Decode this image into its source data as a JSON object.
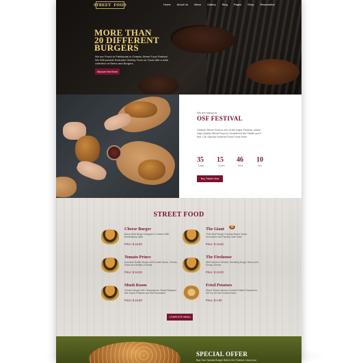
{
  "nav": {
    "logo_left": "STREET",
    "logo_right": "FOOD",
    "items": [
      "Home",
      "About Us",
      "Menu",
      "Gallery",
      "Blog",
      "Pages",
      "Shop",
      "Reservation"
    ]
  },
  "hero": {
    "title_line1": "MORE THAN",
    "title_line2": "20 DIFFERENT",
    "title_line3": "BURGERS",
    "text": "We are Proud to Participate in Orlando Street Food Festival. We Will provide Exclusive Streety Food on Truck with a wide collection of Beers and Burgers.",
    "button": "Discover the Event"
  },
  "festival": {
    "pre": "We are happy to",
    "title": "OSF FESTIVAL",
    "description": "Orlando Street Food is one of the major Festival, where High Quality Street Food is Considered the Health you'll find, Car Special Gourmet Food Truck Here.",
    "countdown": [
      {
        "value": "35",
        "unit": "Days"
      },
      {
        "value": "15",
        "unit": "Hours"
      },
      {
        "value": "46",
        "unit": "Mins"
      },
      {
        "value": "10",
        "unit": "Sec"
      }
    ],
    "button": "Buy Tickets Now"
  },
  "menu": {
    "title": "STREET FOOD",
    "items": [
      {
        "name": "Cheese Burger",
        "desc": "Bacon Beef Burger Wrapped in Cheese With Breathtaking Taste",
        "price": "Price: $ 15.50"
      },
      {
        "name": "The Giant",
        "desc": "Thick Beef Burger Cheddar Bacon Salad, Cucumbers and Paprika Giant Taste",
        "price": "Price: $ 15.50"
      },
      {
        "name": "Tomato Prince",
        "desc": "American Buffalo Burger with Double Bacon, Tomato, Salad and Healthy Cheddar",
        "price": "Price: $ 16.00"
      },
      {
        "name": "The Firehouse",
        "desc": "With Grizzled Cheddar, Streaking Burger, Bacon and Smoky Cheese",
        "price": "Price: $ 13.00"
      },
      {
        "name": "Mush Room",
        "desc": "Chicken Burger with Champignons, Bread Wrapped with Sweet Potatoes and Soft Mozzarella",
        "price": "Price: $ 15.50"
      },
      {
        "name": "Fried Potatoes",
        "desc": "Sliced Potato Delicious Smoked Salted Prepared in Hot Fry Oil with Tomato Sauce",
        "price": "Price: $ 4.00"
      }
    ],
    "button": "COMPLETE MENU"
  },
  "special": {
    "title": "SPECIAL OFFER",
    "sub": "Buy Your Special Burger Before the Festival, show your"
  },
  "colors": {
    "accent": "#7a1230",
    "gold": "#f0d27a",
    "olive": "#4f5a1e"
  }
}
